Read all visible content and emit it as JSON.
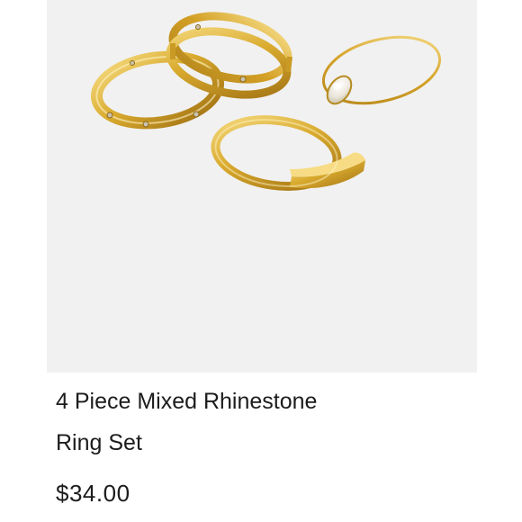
{
  "product": {
    "title_line_1": "4 Piece Mixed Rhinestone",
    "title_line_2": "Ring Set",
    "price": "$34.00",
    "image_icon": "gold-ring-set-photo"
  },
  "colors": {
    "image_background": "#f1f1f1",
    "gold_light": "#f4d77a",
    "gold_mid": "#d7a82a",
    "gold_dark": "#a97815",
    "text": "#1c1c1c"
  }
}
